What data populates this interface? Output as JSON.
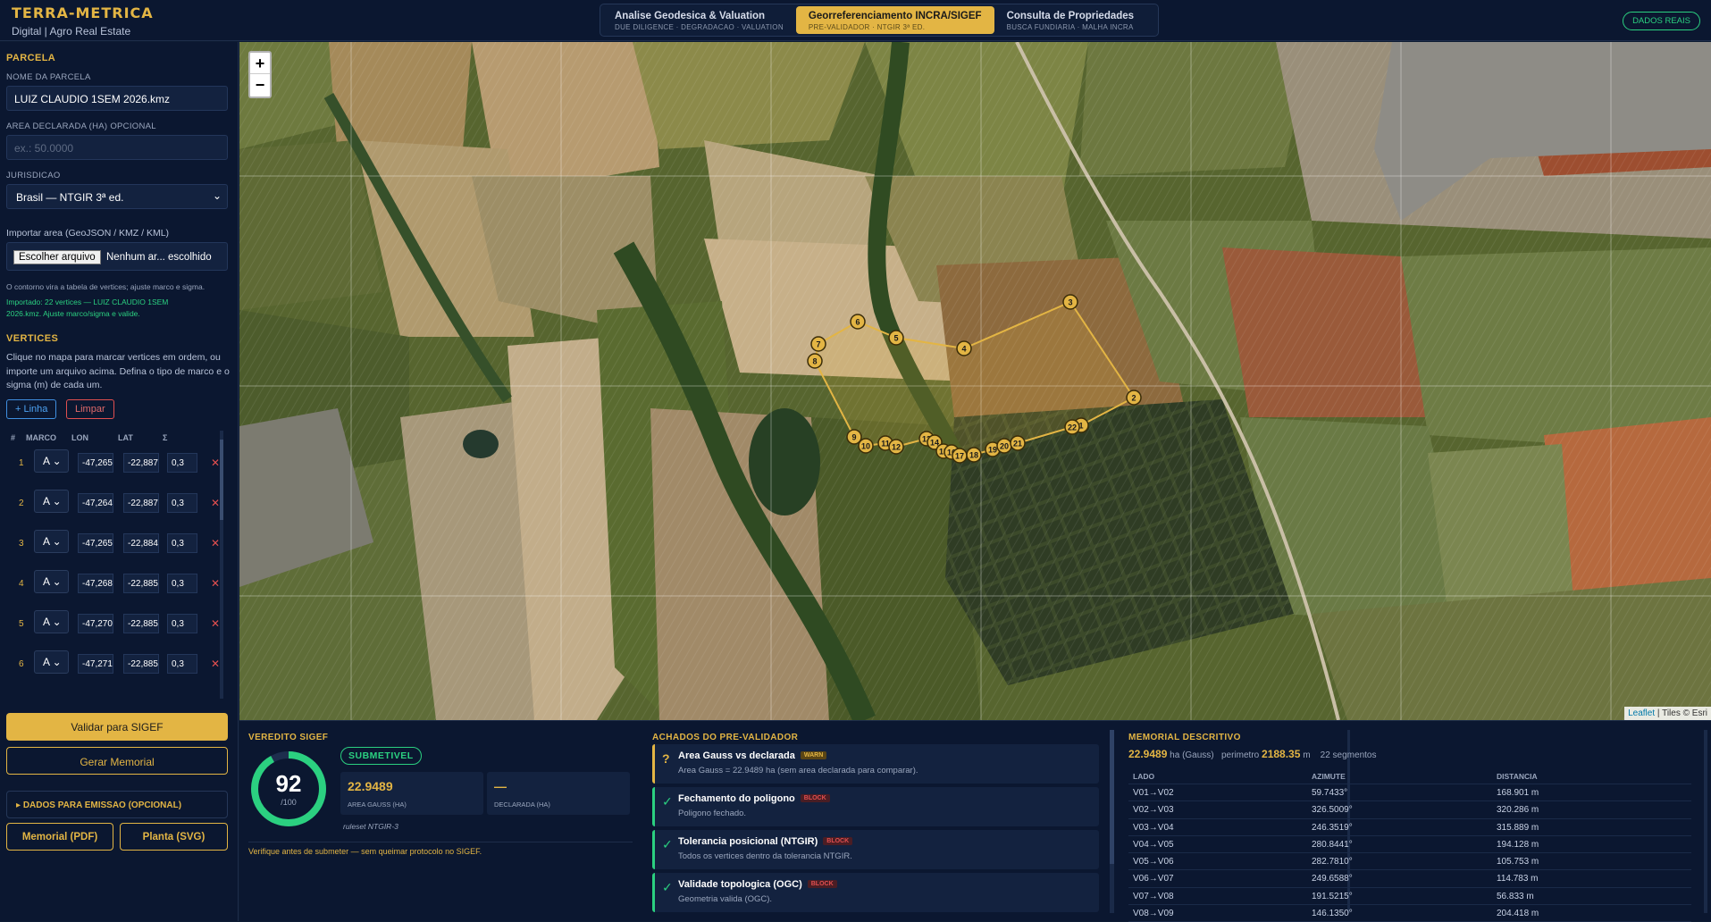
{
  "brand": {
    "title": "TERRA-METRICA",
    "subtitle": "Digital | Agro Real Estate"
  },
  "tabs": [
    {
      "label": "Analise Geodesica & Valuation",
      "sub": "DUE DILIGENCE · DEGRADACAO · VALUATION"
    },
    {
      "label": "Georreferenciamento INCRA/SIGEF",
      "sub": "PRE-VALIDADOR · NTGIR 3ª ED."
    },
    {
      "label": "Consulta de Propriedades",
      "sub": "BUSCA FUNDIARIA · MALHA INCRA"
    }
  ],
  "data_badge": "DADOS REAIS",
  "sidebar": {
    "section_parcela": "PARCELA",
    "nome_label": "NOME DA PARCELA",
    "nome_value": "LUIZ CLAUDIO 1SEM 2026.kmz",
    "area_label": "AREA DECLARADA (HA) OPCIONAL",
    "area_placeholder": "ex.: 50.0000",
    "jurisdicao_label": "JURISDICAO",
    "jurisdicao_value": "Brasil — NTGIR 3ª ed.",
    "import_label": "Importar area (GeoJSON / KMZ / KML)",
    "file_button": "Escolher arquivo",
    "file_status": "Nenhum ar... escolhido",
    "import_hint": "O contorno vira a tabela de vertices; ajuste marco e sigma.",
    "import_result": "Importado: 22 vertices — LUIZ CLAUDIO 1SEM 2026.kmz. Ajuste marco/sigma e valide.",
    "section_vertices": "VERTICES",
    "vertices_help": "Clique no mapa para marcar vertices em ordem, ou importe um arquivo acima. Defina o tipo de marco e o sigma (m) de cada um.",
    "add_line": "+ Linha",
    "clear": "Limpar",
    "table_headers": [
      "#",
      "MARCO",
      "LON",
      "LAT",
      "Σ"
    ],
    "rows": [
      {
        "n": "1",
        "marco": "A",
        "lon": "-47,265",
        "lat": "-22,887",
        "sigma": "0,3"
      },
      {
        "n": "2",
        "marco": "A",
        "lon": "-47,264",
        "lat": "-22,887",
        "sigma": "0,3"
      },
      {
        "n": "3",
        "marco": "A",
        "lon": "-47,265",
        "lat": "-22,884",
        "sigma": "0,3"
      },
      {
        "n": "4",
        "marco": "A",
        "lon": "-47,268",
        "lat": "-22,885",
        "sigma": "0,3"
      },
      {
        "n": "5",
        "marco": "A",
        "lon": "-47,270",
        "lat": "-22,885",
        "sigma": "0,3"
      },
      {
        "n": "6",
        "marco": "A",
        "lon": "-47,271",
        "lat": "-22,885",
        "sigma": "0,3"
      }
    ],
    "validate_button": "Validar para SIGEF",
    "memorial_button": "Gerar Memorial",
    "emissao_toggle": "DADOS PARA EMISSAO (OPCIONAL)",
    "pdf_button": "Memorial (PDF)",
    "svg_button": "Planta (SVG)"
  },
  "map": {
    "zoom_in": "+",
    "zoom_out": "−",
    "attribution_link": "Leaflet",
    "attribution_rest": "| Tiles © Esri",
    "vertex_labels": [
      "1",
      "2",
      "3",
      "4",
      "5",
      "6",
      "7",
      "8",
      "9",
      "10",
      "11",
      "12",
      "13",
      "14",
      "15",
      "16",
      "17",
      "18",
      "19",
      "20",
      "21",
      "22"
    ]
  },
  "verdict": {
    "title": "VEREDITO SIGEF",
    "status": "SUBMETIVEL",
    "score": "92",
    "score_max": "/100",
    "score_value": 92,
    "area_gauss": "22.9489",
    "area_gauss_label": "AREA GAUSS (HA)",
    "declarada": "—",
    "declarada_label": "DECLARADA (HA)",
    "ruleset": "ruleset NTGIR-3",
    "note": "Verifique antes de submeter — sem queimar protocolo no SIGEF."
  },
  "findings": {
    "title": "ACHADOS DO PRE-VALIDADOR",
    "items": [
      {
        "icon": "?",
        "title": "Area Gauss vs declarada",
        "tag": "WARN",
        "desc": "Area Gauss = 22.9489 ha (sem area declarada para comparar)."
      },
      {
        "icon": "✓",
        "title": "Fechamento do poligono",
        "tag": "BLOCK",
        "desc": "Poligono fechado."
      },
      {
        "icon": "✓",
        "title": "Tolerancia posicional (NTGIR)",
        "tag": "BLOCK",
        "desc": "Todos os vertices dentro da tolerancia NTGIR."
      },
      {
        "icon": "✓",
        "title": "Validade topologica (OGC)",
        "tag": "BLOCK",
        "desc": "Geometria valida (OGC)."
      }
    ]
  },
  "memorial": {
    "title": "MEMORIAL DESCRITIVO",
    "area": "22.9489",
    "area_unit": "ha (Gauss)",
    "perimetro_label": "perimetro",
    "perimetro": "2188.35",
    "perimetro_unit": "m",
    "segmentos": "22 segmentos",
    "headers": [
      "LADO",
      "AZIMUTE",
      "DISTANCIA"
    ],
    "rows": [
      {
        "lado": "V01→V02",
        "az": "59.7433°",
        "dist": "168.901 m"
      },
      {
        "lado": "V02→V03",
        "az": "326.5009°",
        "dist": "320.286 m"
      },
      {
        "lado": "V03→V04",
        "az": "246.3519°",
        "dist": "315.889 m"
      },
      {
        "lado": "V04→V05",
        "az": "280.8441°",
        "dist": "194.128 m"
      },
      {
        "lado": "V05→V06",
        "az": "282.7810°",
        "dist": "105.753 m"
      },
      {
        "lado": "V06→V07",
        "az": "249.6588°",
        "dist": "114.783 m"
      },
      {
        "lado": "V07→V08",
        "az": "191.5215°",
        "dist": "56.833 m"
      },
      {
        "lado": "V08→V09",
        "az": "146.1350°",
        "dist": "204.418 m"
      }
    ]
  },
  "colors": {
    "accent": "#e3b544",
    "ok": "#2bd080",
    "warn": "#e3b544",
    "block": "#e14f4f"
  }
}
